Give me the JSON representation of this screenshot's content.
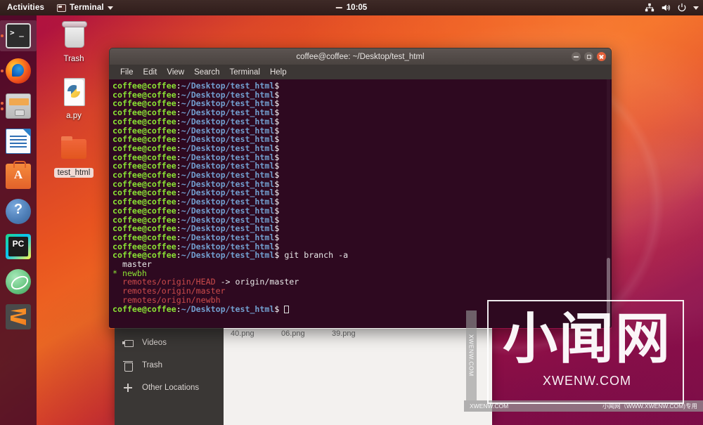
{
  "topbar": {
    "activities": "Activities",
    "app_name": "Terminal",
    "clock": "10:05",
    "indicators": [
      "network-icon",
      "volume-icon",
      "power-icon",
      "caret-down-icon"
    ]
  },
  "launcher": {
    "items": [
      {
        "name": "terminal",
        "label": "Terminal",
        "active": true,
        "pips": 1
      },
      {
        "name": "firefox",
        "label": "Firefox Web Browser",
        "active": false,
        "pips": 1
      },
      {
        "name": "files",
        "label": "Files",
        "active": false,
        "pips": 2
      },
      {
        "name": "writer",
        "label": "LibreOffice Writer",
        "active": false,
        "pips": 0
      },
      {
        "name": "software",
        "label": "Ubuntu Software",
        "active": false,
        "pips": 0
      },
      {
        "name": "help",
        "label": "Help",
        "active": false,
        "pips": 0
      },
      {
        "name": "pycharm",
        "label": "PyCharm",
        "active": false,
        "pips": 0
      },
      {
        "name": "atom",
        "label": "Atom",
        "active": false,
        "pips": 0
      },
      {
        "name": "sublime",
        "label": "Sublime Text",
        "active": false,
        "pips": 0
      }
    ]
  },
  "desktop": {
    "icons": [
      {
        "name": "trash",
        "label": "Trash",
        "selected": false
      },
      {
        "name": "a-py-file",
        "label": "a.py",
        "selected": false
      },
      {
        "name": "test-html-folder",
        "label": "test_html",
        "selected": true
      }
    ]
  },
  "terminal": {
    "title": "coffee@coffee: ~/Desktop/test_html",
    "menu": [
      "File",
      "Edit",
      "View",
      "Search",
      "Terminal",
      "Help"
    ],
    "window_buttons": [
      "minimize",
      "maximize",
      "close"
    ],
    "prompt": {
      "user": "coffee@coffee",
      "colon": ":",
      "path": "~/Desktop/test_html",
      "dollar": "$"
    },
    "empty_prompt_count": 19,
    "command": " git branch -a",
    "output": [
      {
        "text": "  master",
        "color": "white"
      },
      {
        "text": "* newbh",
        "color": "green"
      },
      {
        "text": "  remotes/origin/HEAD",
        "color": "red",
        "suffix": " -> origin/master",
        "suffix_color": "white"
      },
      {
        "text": "  remotes/origin/master",
        "color": "red"
      },
      {
        "text": "  remotes/origin/newbh",
        "color": "red"
      }
    ],
    "colors": {
      "background": "#2e0920",
      "user": "#8ae234",
      "path": "#729fcf",
      "red": "#cc4b4b"
    }
  },
  "files_window": {
    "sidebar": [
      {
        "icon": "video-icon",
        "label": "Videos"
      },
      {
        "icon": "trash-icon",
        "label": "Trash"
      },
      {
        "icon": "plus-icon",
        "label": "Other Locations"
      }
    ],
    "files": [
      "40.png",
      "06.png",
      "39.png"
    ]
  },
  "watermark": {
    "chinese": "小闻网",
    "domain": "XWENW.COM",
    "bar_left": "XWENW.COM",
    "bar_right": "小闻网（WWW.XWENW.COM)专用",
    "side": "XWENW.COM"
  }
}
